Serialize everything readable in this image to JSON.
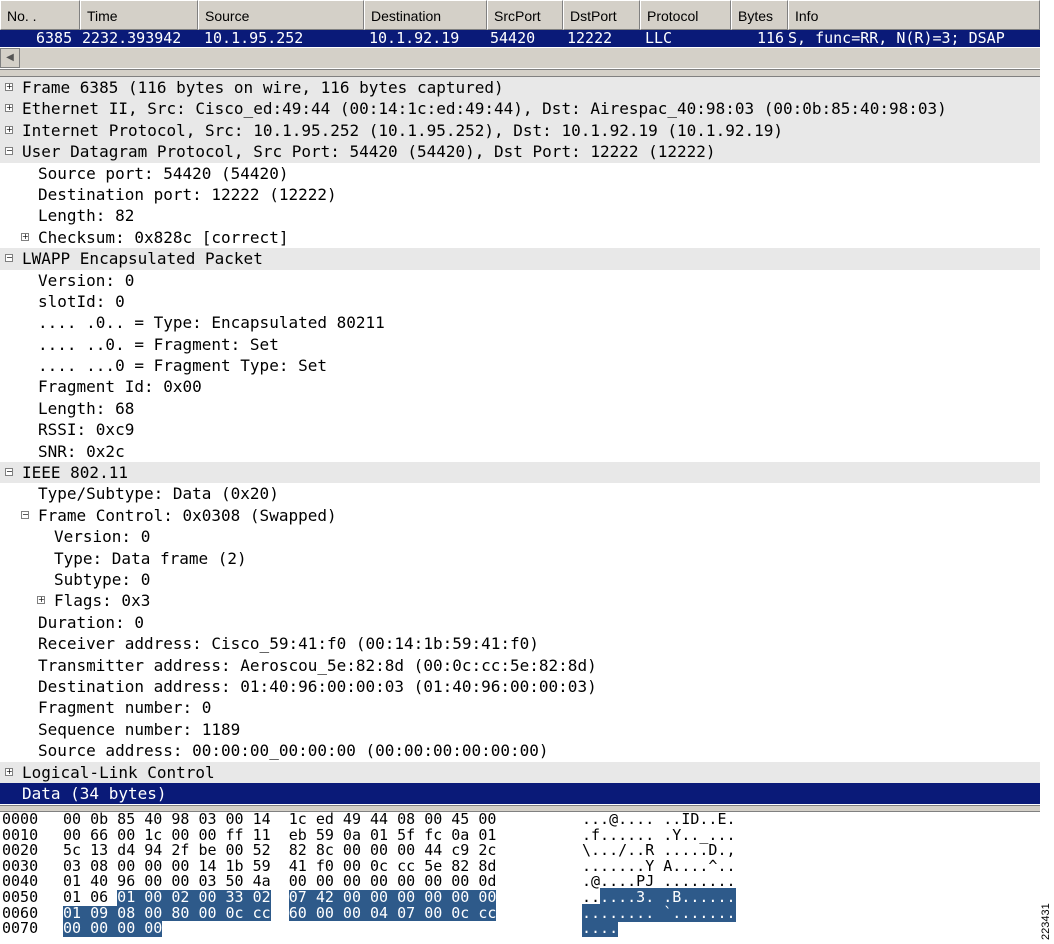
{
  "packet_list": {
    "columns": [
      "No. .",
      "Time",
      "Source",
      "Destination",
      "SrcPort",
      "DstPort",
      "Protocol",
      "Bytes",
      "Info"
    ],
    "row": {
      "no": "6385",
      "time": "2232.393942",
      "source": "10.1.95.252",
      "destination": "10.1.92.19",
      "srcport": "54420",
      "dstport": "12222",
      "protocol": "LLC",
      "bytes": "116",
      "info": "S, func=RR, N(R)=3; DSAP"
    }
  },
  "tree": [
    {
      "level": 0,
      "exp": "+",
      "hdr": true,
      "text": "Frame 6385 (116 bytes on wire, 116 bytes captured)"
    },
    {
      "level": 0,
      "exp": "+",
      "hdr": true,
      "text": "Ethernet II, Src: Cisco_ed:49:44 (00:14:1c:ed:49:44), Dst: Airespac_40:98:03 (00:0b:85:40:98:03)"
    },
    {
      "level": 0,
      "exp": "+",
      "hdr": true,
      "text": "Internet Protocol, Src: 10.1.95.252 (10.1.95.252), Dst: 10.1.92.19 (10.1.92.19)"
    },
    {
      "level": 0,
      "exp": "-",
      "hdr": true,
      "text": "User Datagram Protocol, Src Port: 54420 (54420), Dst Port: 12222 (12222)"
    },
    {
      "level": 1,
      "exp": "",
      "text": "Source port: 54420 (54420)"
    },
    {
      "level": 1,
      "exp": "",
      "text": "Destination port: 12222 (12222)"
    },
    {
      "level": 1,
      "exp": "",
      "text": "Length: 82"
    },
    {
      "level": 1,
      "exp": "+",
      "text": "Checksum: 0x828c [correct]"
    },
    {
      "level": 0,
      "exp": "-",
      "hdr": true,
      "text": "LWAPP Encapsulated Packet"
    },
    {
      "level": 1,
      "exp": "",
      "text": "Version: 0"
    },
    {
      "level": 1,
      "exp": "",
      "text": "slotId: 0"
    },
    {
      "level": 1,
      "exp": "",
      "text": ".... .0.. = Type: Encapsulated 80211"
    },
    {
      "level": 1,
      "exp": "",
      "text": ".... ..0. = Fragment: Set"
    },
    {
      "level": 1,
      "exp": "",
      "text": ".... ...0 = Fragment Type: Set"
    },
    {
      "level": 1,
      "exp": "",
      "text": "Fragment Id: 0x00"
    },
    {
      "level": 1,
      "exp": "",
      "text": "Length: 68"
    },
    {
      "level": 1,
      "exp": "",
      "text": "RSSI: 0xc9"
    },
    {
      "level": 1,
      "exp": "",
      "text": "SNR: 0x2c"
    },
    {
      "level": 0,
      "exp": "-",
      "hdr": true,
      "text": "IEEE 802.11"
    },
    {
      "level": 1,
      "exp": "",
      "text": "Type/Subtype: Data (0x20)"
    },
    {
      "level": 1,
      "exp": "-",
      "text": "Frame Control: 0x0308 (Swapped)"
    },
    {
      "level": 2,
      "exp": "",
      "text": "Version: 0"
    },
    {
      "level": 2,
      "exp": "",
      "text": "Type: Data frame (2)"
    },
    {
      "level": 2,
      "exp": "",
      "text": "Subtype: 0"
    },
    {
      "level": 2,
      "exp": "+",
      "text": "Flags: 0x3"
    },
    {
      "level": 1,
      "exp": "",
      "text": "Duration: 0"
    },
    {
      "level": 1,
      "exp": "",
      "text": "Receiver address: Cisco_59:41:f0 (00:14:1b:59:41:f0)"
    },
    {
      "level": 1,
      "exp": "",
      "text": "Transmitter address: Aeroscou_5e:82:8d (00:0c:cc:5e:82:8d)"
    },
    {
      "level": 1,
      "exp": "",
      "text": "Destination address: 01:40:96:00:00:03 (01:40:96:00:00:03)"
    },
    {
      "level": 1,
      "exp": "",
      "text": "Fragment number: 0"
    },
    {
      "level": 1,
      "exp": "",
      "text": "Sequence number: 1189"
    },
    {
      "level": 1,
      "exp": "",
      "text": "Source address: 00:00:00_00:00:00 (00:00:00:00:00:00)"
    },
    {
      "level": 0,
      "exp": "+",
      "hdr": true,
      "text": "Logical-Link Control"
    },
    {
      "level": 0,
      "exp": "",
      "sel": true,
      "text": "Data (34 bytes)"
    }
  ],
  "hex": [
    {
      "off": "0000",
      "bytes": [
        "00",
        "0b",
        "85",
        "40",
        "98",
        "03",
        "00",
        "14",
        "1c",
        "ed",
        "49",
        "44",
        "08",
        "00",
        "45",
        "00"
      ],
      "ascii": "...@.... ..ID..E."
    },
    {
      "off": "0010",
      "bytes": [
        "00",
        "66",
        "00",
        "1c",
        "00",
        "00",
        "ff",
        "11",
        "eb",
        "59",
        "0a",
        "01",
        "5f",
        "fc",
        "0a",
        "01"
      ],
      "ascii": ".f...... .Y.._..."
    },
    {
      "off": "0020",
      "bytes": [
        "5c",
        "13",
        "d4",
        "94",
        "2f",
        "be",
        "00",
        "52",
        "82",
        "8c",
        "00",
        "00",
        "00",
        "44",
        "c9",
        "2c"
      ],
      "ascii": "\\.../..R .....D.,"
    },
    {
      "off": "0030",
      "bytes": [
        "03",
        "08",
        "00",
        "00",
        "00",
        "14",
        "1b",
        "59",
        "41",
        "f0",
        "00",
        "0c",
        "cc",
        "5e",
        "82",
        "8d"
      ],
      "ascii": ".......Y A....^.."
    },
    {
      "off": "0040",
      "bytes": [
        "01",
        "40",
        "96",
        "00",
        "00",
        "03",
        "50",
        "4a",
        "00",
        "00",
        "00",
        "00",
        "00",
        "00",
        "00",
        "0d"
      ],
      "ascii": ".@....PJ ........"
    },
    {
      "off": "0050",
      "bytes": [
        "01",
        "06",
        "01",
        "00",
        "02",
        "00",
        "33",
        "02",
        "07",
        "42",
        "00",
        "00",
        "00",
        "00",
        "00",
        "00"
      ],
      "ascii": "......3. .B......",
      "hl_from": 2
    },
    {
      "off": "0060",
      "bytes": [
        "01",
        "09",
        "08",
        "00",
        "80",
        "00",
        "0c",
        "cc",
        "60",
        "00",
        "00",
        "04",
        "07",
        "00",
        "0c",
        "cc"
      ],
      "ascii": "........ `.......",
      "hl_from": 0
    },
    {
      "off": "0070",
      "bytes": [
        "00",
        "00",
        "00",
        "00"
      ],
      "ascii": "....",
      "hl_from": 0
    }
  ],
  "figure_id": "223431"
}
